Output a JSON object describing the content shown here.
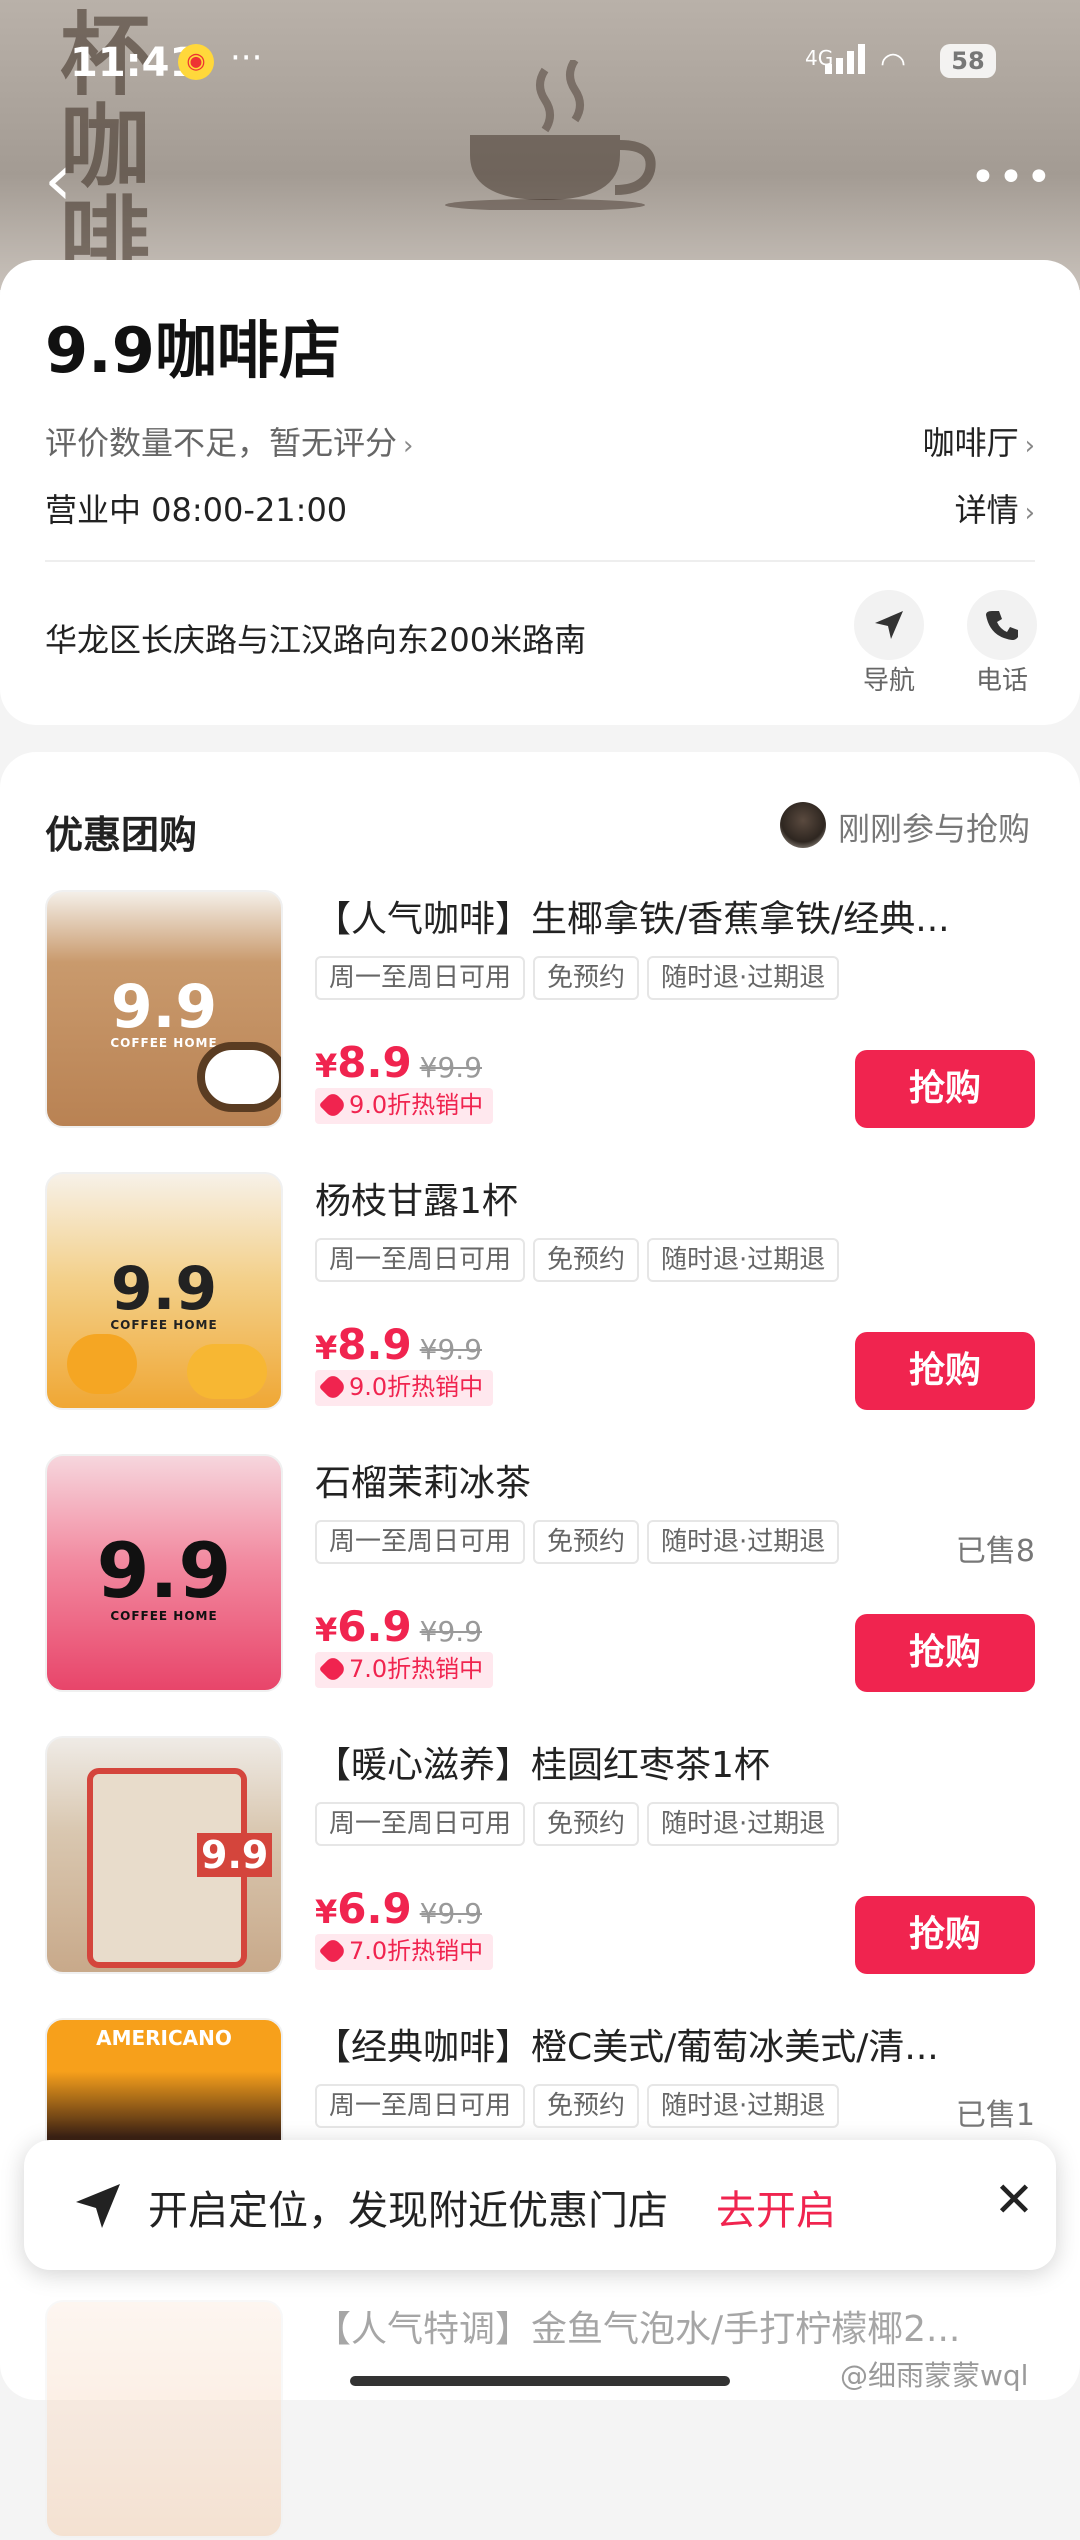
{
  "status_bar": {
    "time": "11:41",
    "network": "4G",
    "battery": "58"
  },
  "shop": {
    "name": "9.9咖啡店",
    "rating_text": "评价数量不足，暂无评分",
    "category": "咖啡厅",
    "hours": "营业中 08:00-21:00",
    "details_label": "详情",
    "address": "华龙区长庆路与江汉路向东200米路南",
    "nav_label": "导航",
    "phone_label": "电话"
  },
  "deals_section": {
    "title": "优惠团购",
    "recent": "刚刚参与抢购",
    "buy_label": "抢购",
    "items": [
      {
        "name": "【人气咖啡】生椰拿铁/香蕉拿铁/经典...",
        "tags": [
          "周一至周日可用",
          "免预约",
          "随时退·过期退"
        ],
        "sold": "",
        "currency": "¥",
        "price": "8.9",
        "orig": "¥9.9",
        "discount": "9.0折热销中"
      },
      {
        "name": "杨枝甘露1杯",
        "tags": [
          "周一至周日可用",
          "免预约",
          "随时退·过期退"
        ],
        "sold": "",
        "currency": "¥",
        "price": "8.9",
        "orig": "¥9.9",
        "discount": "9.0折热销中"
      },
      {
        "name": "石榴茉莉冰茶",
        "tags": [
          "周一至周日可用",
          "免预约",
          "随时退·过期退"
        ],
        "sold": "已售8",
        "currency": "¥",
        "price": "6.9",
        "orig": "¥9.9",
        "discount": "7.0折热销中"
      },
      {
        "name": "【暖心滋养】桂圆红枣茶1杯",
        "tags": [
          "周一至周日可用",
          "免预约",
          "随时退·过期退"
        ],
        "sold": "",
        "currency": "¥",
        "price": "6.9",
        "orig": "¥9.9",
        "discount": "7.0折热销中"
      },
      {
        "name": "【经典咖啡】橙C美式/葡萄冰美式/清...",
        "tags": [
          "周一至周日可用",
          "免预约",
          "随时退·过期退"
        ],
        "sold": "已售1"
      },
      {
        "name": "【人气特调】金鱼气泡水/手打柠檬椰2..."
      }
    ]
  },
  "thumbs": {
    "logo": "9.9",
    "sub": "COFFEE HOME",
    "americano": "AMERICANO"
  },
  "toast": {
    "text": "开启定位，发现附近优惠门店",
    "action": "去开启",
    "close": "✕"
  },
  "watermark": "@细雨蒙蒙wql",
  "colors": {
    "accent": "#f0244f",
    "badge_bg": "#ffe8ee"
  }
}
